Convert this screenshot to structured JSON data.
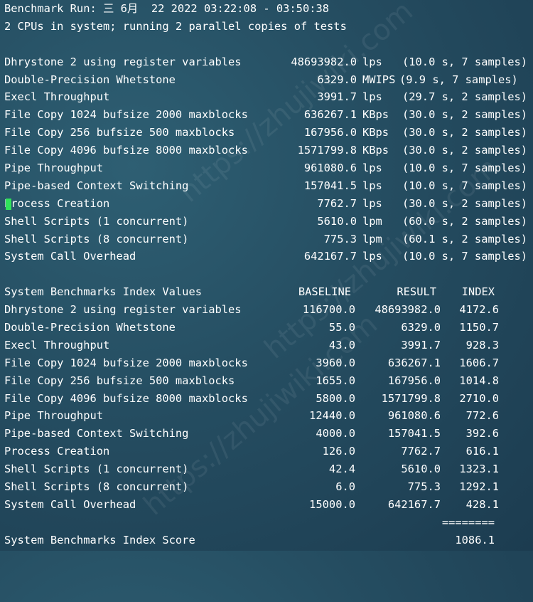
{
  "header": {
    "run_line": "Benchmark Run: 三 6月  22 2022 03:22:08 - 03:50:38",
    "cpu_line": "2 CPUs in system; running 2 parallel copies of tests"
  },
  "raw_results": [
    {
      "name": "Dhrystone 2 using register variables",
      "value": "48693982.0",
      "unit": "lps",
      "detail": "(10.0 s, 7 samples)"
    },
    {
      "name": "Double-Precision Whetstone",
      "value": "6329.0",
      "unit": "MWIPS",
      "detail": "(9.9 s, 7 samples)"
    },
    {
      "name": "Execl Throughput",
      "value": "3991.7",
      "unit": "lps",
      "detail": "(29.7 s, 2 samples)"
    },
    {
      "name": "File Copy 1024 bufsize 2000 maxblocks",
      "value": "636267.1",
      "unit": "KBps",
      "detail": "(30.0 s, 2 samples)"
    },
    {
      "name": "File Copy 256 bufsize 500 maxblocks",
      "value": "167956.0",
      "unit": "KBps",
      "detail": "(30.0 s, 2 samples)"
    },
    {
      "name": "File Copy 4096 bufsize 8000 maxblocks",
      "value": "1571799.8",
      "unit": "KBps",
      "detail": "(30.0 s, 2 samples)"
    },
    {
      "name": "Pipe Throughput",
      "value": "961080.6",
      "unit": "lps",
      "detail": "(10.0 s, 7 samples)"
    },
    {
      "name": "Pipe-based Context Switching",
      "value": "157041.5",
      "unit": "lps",
      "detail": "(10.0 s, 7 samples)"
    },
    {
      "name": "Process Creation",
      "value": "7762.7",
      "unit": "lps",
      "detail": "(30.0 s, 2 samples)"
    },
    {
      "name": "Shell Scripts (1 concurrent)",
      "value": "5610.0",
      "unit": "lpm",
      "detail": "(60.0 s, 2 samples)"
    },
    {
      "name": "Shell Scripts (8 concurrent)",
      "value": "775.3",
      "unit": "lpm",
      "detail": "(60.1 s, 2 samples)"
    },
    {
      "name": "System Call Overhead",
      "value": "642167.7",
      "unit": "lps",
      "detail": "(10.0 s, 7 samples)"
    }
  ],
  "index_table": {
    "title": "System Benchmarks Index Values",
    "headers": {
      "baseline": "BASELINE",
      "result": "RESULT",
      "index": "INDEX"
    },
    "rows": [
      {
        "name": "Dhrystone 2 using register variables",
        "baseline": "116700.0",
        "result": "48693982.0",
        "index": "4172.6"
      },
      {
        "name": "Double-Precision Whetstone",
        "baseline": "55.0",
        "result": "6329.0",
        "index": "1150.7"
      },
      {
        "name": "Execl Throughput",
        "baseline": "43.0",
        "result": "3991.7",
        "index": "928.3"
      },
      {
        "name": "File Copy 1024 bufsize 2000 maxblocks",
        "baseline": "3960.0",
        "result": "636267.1",
        "index": "1606.7"
      },
      {
        "name": "File Copy 256 bufsize 500 maxblocks",
        "baseline": "1655.0",
        "result": "167956.0",
        "index": "1014.8"
      },
      {
        "name": "File Copy 4096 bufsize 8000 maxblocks",
        "baseline": "5800.0",
        "result": "1571799.8",
        "index": "2710.0"
      },
      {
        "name": "Pipe Throughput",
        "baseline": "12440.0",
        "result": "961080.6",
        "index": "772.6"
      },
      {
        "name": "Pipe-based Context Switching",
        "baseline": "4000.0",
        "result": "157041.5",
        "index": "392.6"
      },
      {
        "name": "Process Creation",
        "baseline": "126.0",
        "result": "7762.7",
        "index": "616.1"
      },
      {
        "name": "Shell Scripts (1 concurrent)",
        "baseline": "42.4",
        "result": "5610.0",
        "index": "1323.1"
      },
      {
        "name": "Shell Scripts (8 concurrent)",
        "baseline": "6.0",
        "result": "775.3",
        "index": "1292.1"
      },
      {
        "name": "System Call Overhead",
        "baseline": "15000.0",
        "result": "642167.7",
        "index": "428.1"
      }
    ],
    "separator": "========",
    "score_label": "System Benchmarks Index Score",
    "score_value": "1086.1"
  },
  "watermark": "https://zhujiwiki.com",
  "colors": {
    "cursor": "#2fe35a",
    "text": "#ffffff"
  }
}
